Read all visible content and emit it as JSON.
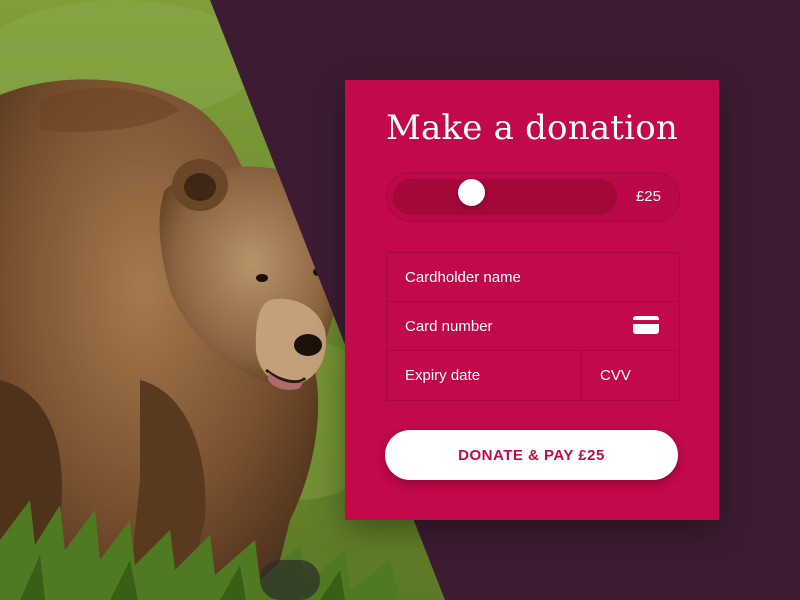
{
  "photo": {
    "subject_icon": "bear-photo"
  },
  "donation_card": {
    "title": "Make a donation",
    "slider": {
      "amount_label": "£25",
      "value_fraction": 0.33
    },
    "fields": {
      "cardholder_placeholder": "Cardholder name",
      "card_number_placeholder": "Card number",
      "card_icon": "credit-card-icon",
      "expiry_placeholder": "Expiry date",
      "cvv_placeholder": "CVV"
    },
    "submit_label": "DONATE & PAY £25"
  },
  "colors": {
    "background": "#3d1c33",
    "card": "#c2094b",
    "track": "#a30839",
    "button_text": "#c2094b"
  }
}
